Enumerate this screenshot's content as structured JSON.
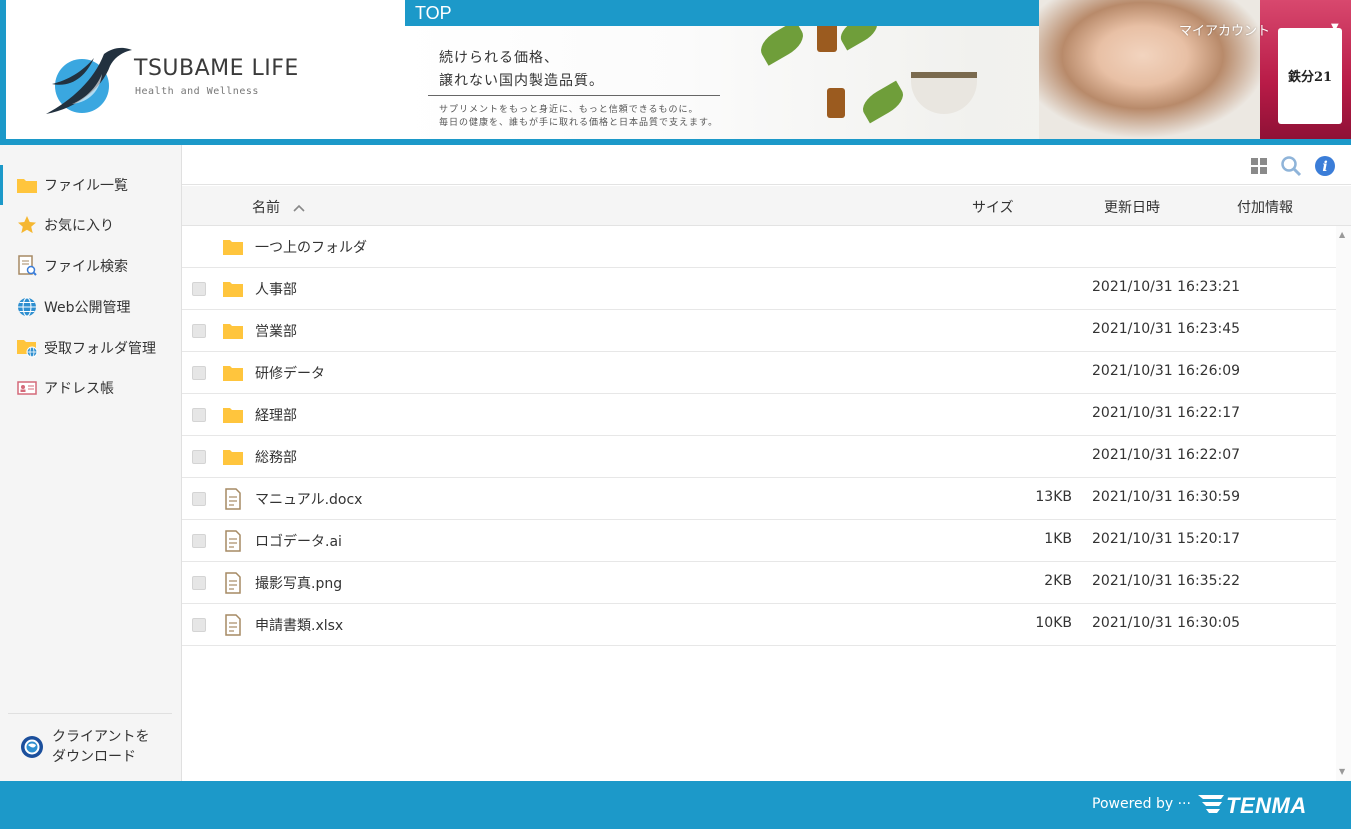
{
  "header": {
    "logo_title": "TSUBAME LIFE",
    "logo_subtitle": "Health and Wellness",
    "top_tab": "TOP",
    "banner_line1": "続けられる価格、",
    "banner_line2": "譲れない国内製造品質。",
    "banner_sub1": "サプリメントをもっと身近に、もっと信頼できるものに。",
    "banner_sub2": "毎日の健康を、誰もが手に取れる価格と日本品質で支えます。",
    "product_name": "鉄分21",
    "account_label": "マイアカウント"
  },
  "sidebar": {
    "items": [
      {
        "label": "ファイル一覧"
      },
      {
        "label": "お気に入り"
      },
      {
        "label": "ファイル検索"
      },
      {
        "label": "Web公開管理"
      },
      {
        "label": "受取フォルダ管理"
      },
      {
        "label": "アドレス帳"
      }
    ],
    "download_line1": "クライアントを",
    "download_line2": "ダウンロード"
  },
  "table": {
    "col_name": "名前",
    "col_size": "サイズ",
    "col_updated": "更新日時",
    "col_extra": "付加情報",
    "parent_folder": "一つ上のフォルダ",
    "rows": [
      {
        "name": "人事部",
        "type": "folder",
        "size": "",
        "date": "2021/10/31 16:23:21"
      },
      {
        "name": "営業部",
        "type": "folder",
        "size": "",
        "date": "2021/10/31 16:23:45"
      },
      {
        "name": "研修データ",
        "type": "folder",
        "size": "",
        "date": "2021/10/31 16:26:09"
      },
      {
        "name": "経理部",
        "type": "folder",
        "size": "",
        "date": "2021/10/31 16:22:17"
      },
      {
        "name": "総務部",
        "type": "folder",
        "size": "",
        "date": "2021/10/31 16:22:07"
      },
      {
        "name": "マニュアル.docx",
        "type": "file",
        "size": "13KB",
        "date": "2021/10/31 16:30:59"
      },
      {
        "name": "ロゴデータ.ai",
        "type": "file",
        "size": "1KB",
        "date": "2021/10/31 15:20:17"
      },
      {
        "name": "撮影写真.png",
        "type": "file",
        "size": "2KB",
        "date": "2021/10/31 16:35:22"
      },
      {
        "name": "申請書類.xlsx",
        "type": "file",
        "size": "10KB",
        "date": "2021/10/31 16:30:05"
      }
    ]
  },
  "footer": {
    "powered_by": "Powered by ···",
    "brand": "TENMA"
  },
  "colors": {
    "accent": "#1c99c9",
    "folder": "#ffc53d",
    "info": "#3b7dd8"
  }
}
